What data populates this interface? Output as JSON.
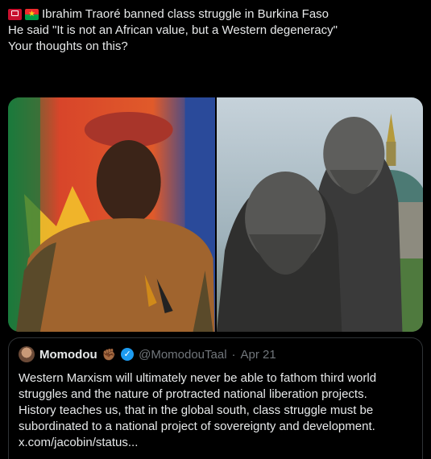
{
  "post": {
    "flags": [
      "myanmar-flag-icon",
      "burkina-faso-flag-icon"
    ],
    "line1": "Ibrahim Traoré banned class struggle in Burkina Faso",
    "line2": "He said \"It is not an African value, but a Western degeneracy\"",
    "line3": "Your thoughts on this?"
  },
  "media": {
    "images": [
      "portrait-photo-soldier-red-beret",
      "statue-photo-marx-engels"
    ]
  },
  "quote": {
    "name": "Momodou",
    "handle": "@MomodouTaal",
    "separator": "·",
    "date": "Apr 21",
    "lines": [
      "Western Marxism will ultimately never be able to fathom third world",
      "struggles and the nature of protracted national liberation projects.",
      "History teaches us, that in the global south, class struggle must be",
      "subordinated to a national project of sovereignty and development.",
      "x.com/jacobin/status..."
    ]
  },
  "colors": {
    "background": "#000000",
    "text": "#e7e9ea",
    "muted": "#71767b",
    "border": "#2f3336",
    "verified": "#1d9bf0"
  }
}
